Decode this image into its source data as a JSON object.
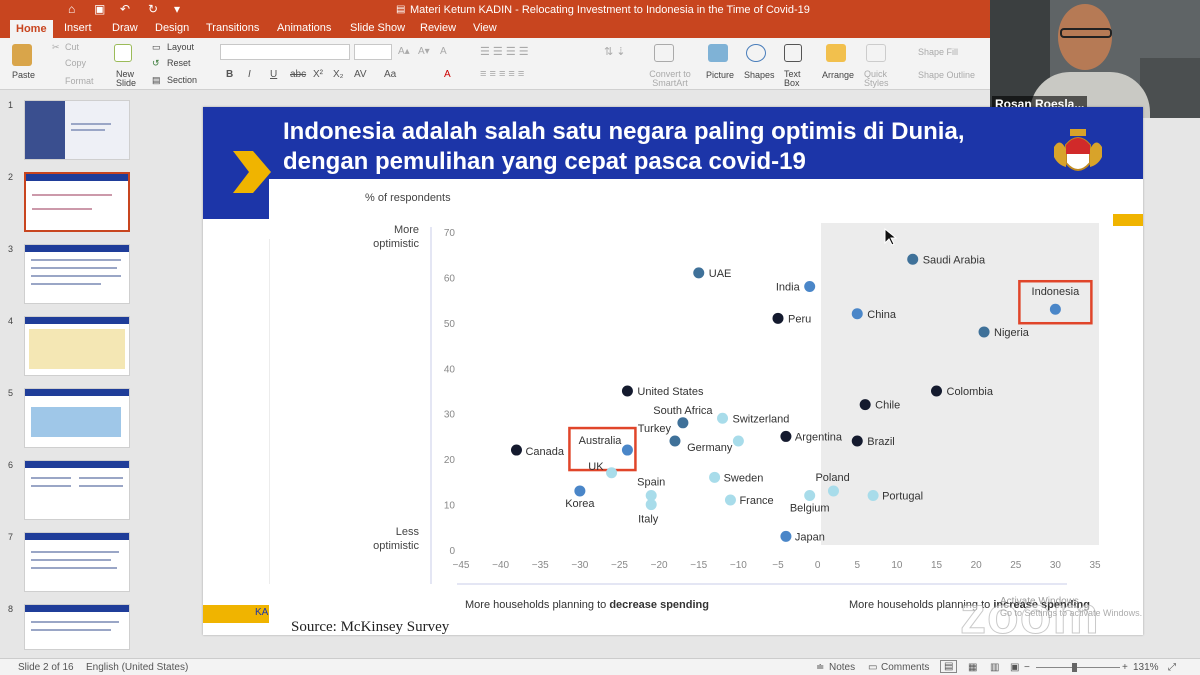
{
  "window": {
    "title": "Materi Ketum KADIN - Relocating Investment to Indonesia in the Time of Covid-19",
    "quick_access": {
      "home": "⌂",
      "save": "▣",
      "undo": "↶",
      "redo": "↻",
      "more": "▾"
    }
  },
  "ribbon": {
    "tabs": [
      "Home",
      "Insert",
      "Draw",
      "Design",
      "Transitions",
      "Animations",
      "Slide Show",
      "Review",
      "View"
    ],
    "active_tab": "Home",
    "clipboard": {
      "paste": "Paste",
      "cut": "Cut",
      "copy": "Copy",
      "format": "Format"
    },
    "slides": {
      "new_slide": "New Slide",
      "layout": "Layout",
      "reset": "Reset",
      "section": "Section"
    },
    "font_buttons": [
      "B",
      "I",
      "U",
      "abc",
      "X²",
      "X₂",
      "AV",
      "Aa",
      "A"
    ],
    "font_size_buttons": [
      "A▴",
      "A▾",
      "A"
    ],
    "convert_smartart": "Convert to SmartArt",
    "picture": "Picture",
    "shapes": "Shapes",
    "text_box": "Text Box",
    "arrange": "Arrange",
    "quick_styles": "Quick Styles",
    "shape_fill": "Shape Fill",
    "shape_outline": "Shape Outline",
    "accent": "#c8451f"
  },
  "video": {
    "participant_name": "Rosan Roesla..."
  },
  "thumbnails": [
    {
      "num": "1"
    },
    {
      "num": "2"
    },
    {
      "num": "3"
    },
    {
      "num": "4"
    },
    {
      "num": "5"
    },
    {
      "num": "6"
    },
    {
      "num": "7"
    },
    {
      "num": "8"
    }
  ],
  "selected_slide": "2",
  "slide": {
    "title_line1": "Indonesia adalah salah satu negara paling optimis di Dunia,",
    "title_line2": "dengan pemulihan yang cepat pasca covid-19",
    "source": "Source: McKinsey Survey",
    "bottom_tag": "KA",
    "header_color": "#1c35a8",
    "gold_color": "#f0b400"
  },
  "chart_data": {
    "type": "scatter",
    "ylabel": "% of respondents",
    "y_top_label": "More optimistic",
    "y_bottom_label": "Less optimistic",
    "x_left_label_prefix": "More households planning to ",
    "x_left_label_bold": "decrease spending",
    "x_right_label_prefix": "More households planning to ",
    "x_right_label_bold": "increase spending",
    "xlim": [
      -45,
      35
    ],
    "ylim": [
      0,
      70
    ],
    "x_ticks": [
      "−45",
      "−40",
      "−35",
      "−30",
      "−25",
      "−20",
      "−15",
      "−10",
      "−5",
      "0",
      "5",
      "10",
      "15",
      "20",
      "25",
      "30",
      "35"
    ],
    "y_ticks": [
      "0",
      "10",
      "20",
      "30",
      "40",
      "50",
      "60",
      "70"
    ],
    "highlight_region": "x ≥ 0 (shaded)",
    "highlighted": [
      "Indonesia",
      "Australia"
    ],
    "colors": {
      "dark": "#141a2e",
      "mid": "#4a86c8",
      "steel": "#3f7199",
      "light": "#a8dcea",
      "highlight_box": "#e0452a"
    },
    "points": [
      {
        "name": "UAE",
        "x": -15,
        "y": 61,
        "color": "steel"
      },
      {
        "name": "India",
        "x": -1,
        "y": 58,
        "color": "mid"
      },
      {
        "name": "Saudi Arabia",
        "x": 12,
        "y": 64,
        "color": "steel"
      },
      {
        "name": "Indonesia",
        "x": 30,
        "y": 53,
        "color": "mid"
      },
      {
        "name": "China",
        "x": 5,
        "y": 52,
        "color": "mid"
      },
      {
        "name": "Peru",
        "x": -5,
        "y": 51,
        "color": "dark"
      },
      {
        "name": "Nigeria",
        "x": 21,
        "y": 48,
        "color": "steel"
      },
      {
        "name": "United States",
        "x": -24,
        "y": 35,
        "color": "dark"
      },
      {
        "name": "Colombia",
        "x": 15,
        "y": 35,
        "color": "dark"
      },
      {
        "name": "Chile",
        "x": 6,
        "y": 32,
        "color": "dark"
      },
      {
        "name": "South Africa",
        "x": -17,
        "y": 28,
        "color": "steel"
      },
      {
        "name": "Switzerland",
        "x": -12,
        "y": 29,
        "color": "light"
      },
      {
        "name": "Turkey",
        "x": -18,
        "y": 24,
        "color": "steel"
      },
      {
        "name": "Germany",
        "x": -10,
        "y": 24,
        "color": "light"
      },
      {
        "name": "Argentina",
        "x": -4,
        "y": 25,
        "color": "dark"
      },
      {
        "name": "Brazil",
        "x": 5,
        "y": 24,
        "color": "dark"
      },
      {
        "name": "Australia",
        "x": -24,
        "y": 22,
        "color": "mid"
      },
      {
        "name": "Canada",
        "x": -38,
        "y": 22,
        "color": "dark"
      },
      {
        "name": "UK",
        "x": -26,
        "y": 17,
        "color": "light"
      },
      {
        "name": "Sweden",
        "x": -13,
        "y": 16,
        "color": "light"
      },
      {
        "name": "Poland",
        "x": 2,
        "y": 13,
        "color": "light"
      },
      {
        "name": "Korea",
        "x": -30,
        "y": 13,
        "color": "mid"
      },
      {
        "name": "Spain",
        "x": -21,
        "y": 12,
        "color": "light"
      },
      {
        "name": "Italy",
        "x": -21,
        "y": 10,
        "color": "light"
      },
      {
        "name": "France",
        "x": -11,
        "y": 11,
        "color": "light"
      },
      {
        "name": "Belgium",
        "x": -1,
        "y": 12,
        "color": "light"
      },
      {
        "name": "Portugal",
        "x": 7,
        "y": 12,
        "color": "light"
      },
      {
        "name": "Japan",
        "x": -4,
        "y": 3,
        "color": "mid"
      }
    ]
  },
  "statusbar": {
    "slide_info": "Slide 2 of 16",
    "language": "English (United States)",
    "notes": "Notes",
    "comments": "Comments",
    "zoom": "131%"
  },
  "overlay": {
    "zoom_watermark": "zoom",
    "activate_line1": "Activate Windows",
    "activate_line2": "Go to Settings to activate Windows."
  }
}
